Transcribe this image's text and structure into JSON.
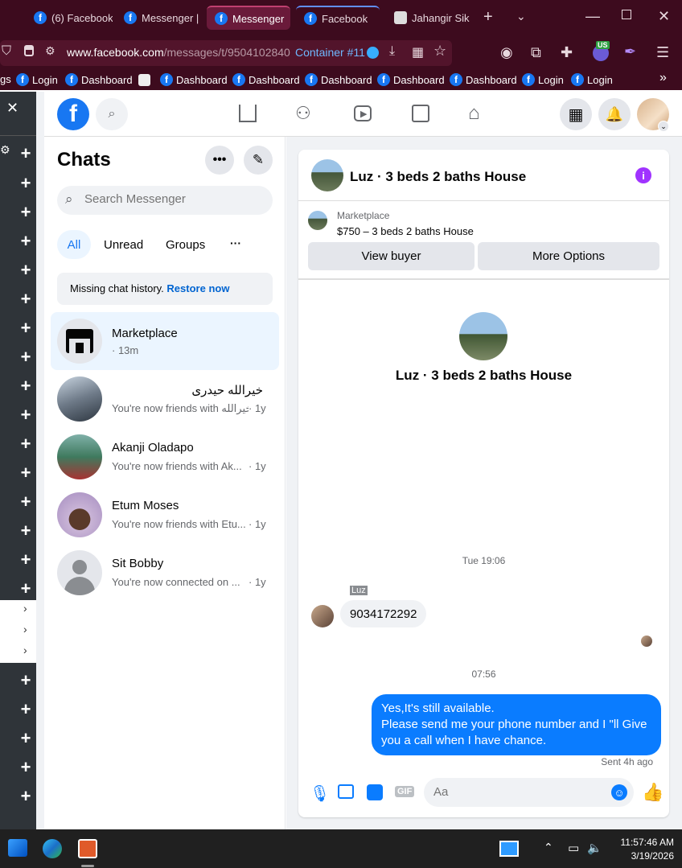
{
  "browser": {
    "tabs": [
      {
        "label": "(6) Facebook",
        "active": false
      },
      {
        "label": "Messenger | F",
        "active": false
      },
      {
        "label": "Messenger",
        "active": true
      },
      {
        "label": "Facebook",
        "active": false
      },
      {
        "label": "Jahangir Sikd",
        "active": false
      }
    ],
    "url_host": "www.facebook.com",
    "url_path": "/messages/t/9504102840",
    "container_label": "Container #11",
    "bookmarks": [
      "gs",
      "Login",
      "Dashboard",
      "Dashboard",
      "Dashboard",
      "Dashboard",
      "Dashboard",
      "Dashboard",
      "Login",
      "Login"
    ],
    "ext_badge": "US"
  },
  "fb": {
    "logo": "f"
  },
  "chats": {
    "title": "Chats",
    "search_placeholder": "Search Messenger",
    "filters": [
      "All",
      "Unread",
      "Groups"
    ],
    "missing_text": "Missing chat history.",
    "restore_link": "Restore now",
    "items": [
      {
        "name": "Marketplace",
        "preview": "",
        "time": "· 13m"
      },
      {
        "name": "خیرالله حیدری",
        "preview": "You're now friends with خیرالله...",
        "time": "· 1y"
      },
      {
        "name": "Akanji Oladapo",
        "preview": "You're now friends with Ak...",
        "time": "· 1y"
      },
      {
        "name": "Etum Moses",
        "preview": "You're now friends with Etu...",
        "time": "· 1y"
      },
      {
        "name": "Sit Bobby",
        "preview": "You're now connected on ...",
        "time": "· 1y"
      }
    ]
  },
  "conversation": {
    "title": "Luz · 3 beds 2 baths House",
    "listing_source": "Marketplace",
    "listing_title": "$750 – 3 beds 2 baths House",
    "view_buyer": "View buyer",
    "more_options": "More Options",
    "center_title": "Luz · 3 beds 2 baths House",
    "timestamp1": "Tue 19:06",
    "sender_label": "Luz",
    "incoming_message": "9034172292",
    "timestamp2": "07:56",
    "outgoing_message": "Yes,It's still available.\nPlease send me your phone number and I \"ll Give you a call when I have chance.",
    "sent_status": "Sent 4h ago",
    "composer_placeholder": "Aa"
  },
  "taskbar": {
    "time": "11:57:46 AM",
    "date": "3/19/2026"
  },
  "colors": {
    "browser_bg": "#3d0b1e",
    "fb_blue": "#1877f2",
    "messenger_bubble": "#0a7cff",
    "accent_purple": "#a033ff"
  }
}
